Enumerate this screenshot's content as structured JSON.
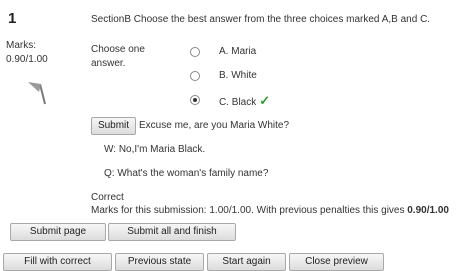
{
  "question": {
    "number": "1",
    "marks_label": "Marks:",
    "marks_value": "0.90/1.00",
    "text": "SectionB Choose the best answer from the three choices marked A,B and C.",
    "prompt": "Choose one answer.",
    "options": [
      {
        "letter": "A.",
        "label": "Maria",
        "selected": false
      },
      {
        "letter": "B.",
        "label": "White",
        "selected": false
      },
      {
        "letter": "C.",
        "label": "Black",
        "selected": true,
        "correct": true
      }
    ],
    "submit_label": "Submit",
    "audio_text": "Excuse me, are you Maria White?",
    "dialogue_w": "W: No,I'm Maria Black.",
    "dialogue_q": "Q: What's the woman's family name?",
    "result": "Correct",
    "marks_submission_prefix": "Marks for this submission: 1.00/1.00. With previous penalties this gives ",
    "marks_submission_value": "0.90/1.00"
  },
  "actions": {
    "submit_page": "Submit page",
    "submit_all": "Submit all and finish"
  },
  "preview": {
    "fill_correct": "Fill with correct",
    "previous_state": "Previous state",
    "start_again": "Start again",
    "close_preview": "Close preview"
  },
  "icons": {
    "flag": "flag-icon",
    "check": "checkmark-icon"
  },
  "colors": {
    "check": "#2e9d2e"
  }
}
